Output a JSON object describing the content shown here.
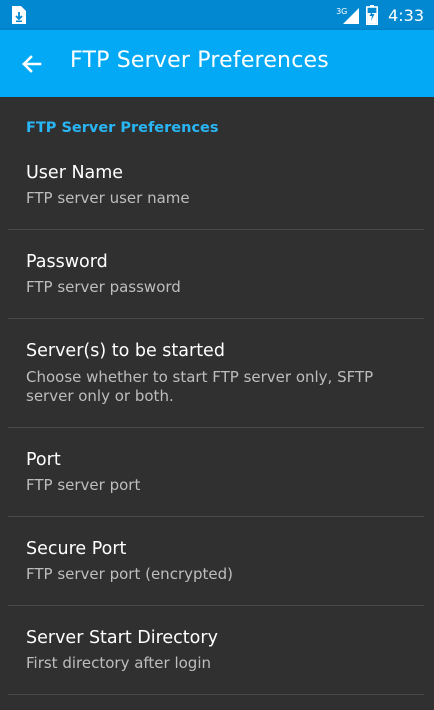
{
  "status_bar": {
    "network_type": "3G",
    "time": "4:33",
    "icons": [
      "download-file-icon",
      "signal-icon",
      "battery-charging-icon"
    ]
  },
  "app_bar": {
    "back_icon": "arrow-back-icon",
    "title": "FTP Server Preferences"
  },
  "preferences": {
    "category": "FTP Server Preferences",
    "items": [
      {
        "title": "User Name",
        "summary": "FTP server user name"
      },
      {
        "title": "Password",
        "summary": "FTP server password"
      },
      {
        "title": "Server(s) to be started",
        "summary": "Choose whether to start FTP server only, SFTP server only or both."
      },
      {
        "title": "Port",
        "summary": "FTP server port"
      },
      {
        "title": "Secure Port",
        "summary": "FTP server port (encrypted)"
      },
      {
        "title": "Server Start Directory",
        "summary": "First directory after login"
      }
    ]
  },
  "colors": {
    "status_bar": "#0288d1",
    "app_bar": "#03a9f4",
    "background": "#303030",
    "accent": "#29b6f6"
  }
}
